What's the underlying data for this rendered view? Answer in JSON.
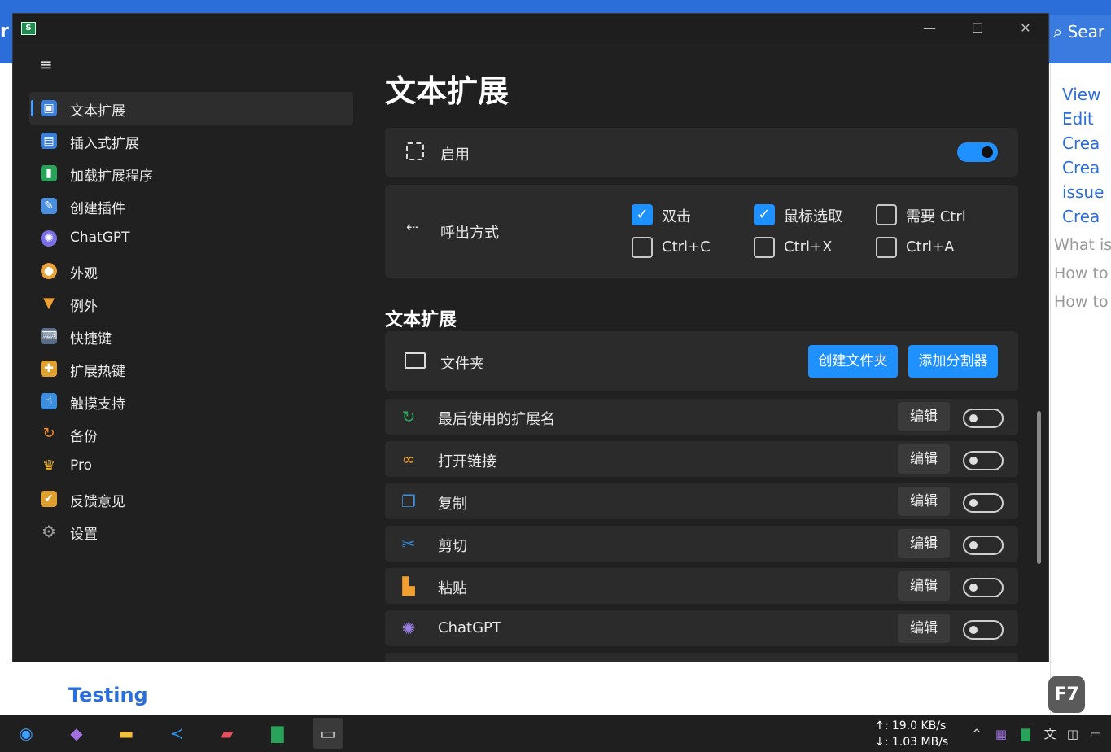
{
  "background": {
    "top_left_letter": "r",
    "search_label": "Sear",
    "side_links": [
      "View",
      "Edit",
      "Crea",
      "Crea",
      "issue",
      "Crea"
    ],
    "faq_links": [
      "What is",
      "How to",
      "How to"
    ],
    "testing_heading": "Testing",
    "key_badge": "F7"
  },
  "window": {
    "app_icon_letter": "S",
    "controls": {
      "minimize": "—",
      "maximize": "☐",
      "close": "✕"
    }
  },
  "sidebar": {
    "items": [
      {
        "label": "文本扩展",
        "icon": "text-expansion-icon",
        "active": true
      },
      {
        "label": "插入式扩展",
        "icon": "insert-expansion-icon"
      },
      {
        "label": "加载扩展程序",
        "icon": "load-extension-icon"
      },
      {
        "label": "创建插件",
        "icon": "create-plugin-icon"
      },
      {
        "label": "ChatGPT",
        "icon": "chatgpt-icon"
      },
      {
        "label": "外观",
        "icon": "palette-icon"
      },
      {
        "label": "例外",
        "icon": "funnel-exception-icon"
      },
      {
        "label": "快捷键",
        "icon": "keyboard-icon"
      },
      {
        "label": "扩展热键",
        "icon": "hotkey-icon"
      },
      {
        "label": "触摸支持",
        "icon": "touch-icon"
      },
      {
        "label": "备份",
        "icon": "backup-icon"
      },
      {
        "label": "Pro",
        "icon": "crown-icon"
      },
      {
        "label": "反馈意见",
        "icon": "feedback-icon"
      },
      {
        "label": "设置",
        "icon": "gear-icon"
      }
    ]
  },
  "main": {
    "title": "文本扩展",
    "enable": {
      "label": "启用",
      "on": true
    },
    "trigger": {
      "label": "呼出方式",
      "options": [
        {
          "label": "双击",
          "checked": true
        },
        {
          "label": "鼠标选取",
          "checked": true
        },
        {
          "label": "需要 Ctrl",
          "checked": false
        },
        {
          "label": "Ctrl+C",
          "checked": false
        },
        {
          "label": "Ctrl+X",
          "checked": false
        },
        {
          "label": "Ctrl+A",
          "checked": false
        }
      ]
    },
    "section_title": "文本扩展",
    "folder": {
      "label": "文件夹",
      "create_folder": "创建文件夹",
      "add_separator": "添加分割器"
    },
    "edit_label": "编辑",
    "extensions": [
      {
        "name": "最后使用的扩展名",
        "icon": "refresh-icon",
        "enabled": false
      },
      {
        "name": "打开链接",
        "icon": "link-icon",
        "enabled": false
      },
      {
        "name": "复制",
        "icon": "copy-icon",
        "enabled": false
      },
      {
        "name": "剪切",
        "icon": "scissors-icon",
        "enabled": false
      },
      {
        "name": "粘贴",
        "icon": "paste-icon",
        "enabled": false
      },
      {
        "name": "ChatGPT",
        "icon": "chatgpt-icon",
        "enabled": false
      }
    ]
  },
  "taskbar": {
    "apps": [
      "edge-icon",
      "visual-studio-icon",
      "file-explorer-icon",
      "vscode-icon",
      "bookmark-app-icon",
      "app-s-icon",
      "remote-desktop-icon"
    ],
    "upload": "↑: 19.0 KB/s",
    "download": "↓: 1.03 MB/s"
  }
}
